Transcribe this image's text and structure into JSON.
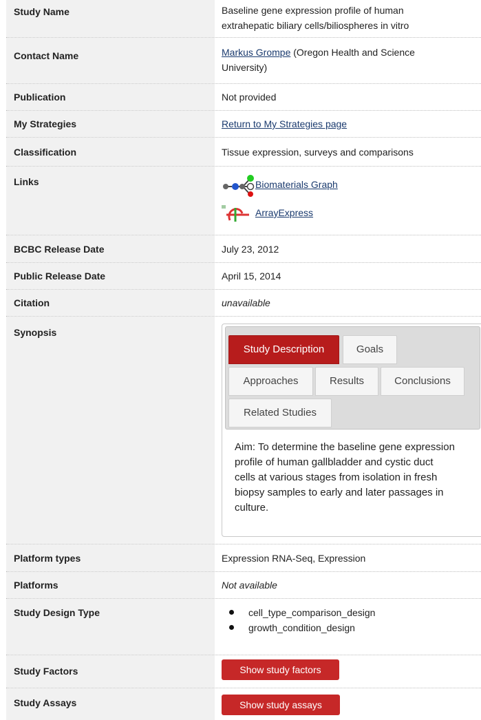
{
  "rows": {
    "study_name": {
      "label": "Study Name",
      "value": "Baseline gene expression profile of human extrahepatic biliary cells/biliospheres in vitro"
    },
    "contact_name": {
      "label": "Contact Name",
      "link": "Markus Grompe",
      "rest": " (Oregon Health and Science University)"
    },
    "publication": {
      "label": "Publication",
      "value": "Not provided"
    },
    "my_strategies": {
      "label": "My Strategies",
      "link": "Return to My Strategies page"
    },
    "classification": {
      "label": "Classification",
      "value": "Tissue expression, surveys and comparisons"
    },
    "links": {
      "label": "Links",
      "items": [
        {
          "icon": "biomaterials-graph-icon",
          "label": "Biomaterials Graph"
        },
        {
          "icon": "arrayexpress-icon",
          "label": "ArrayExpress"
        }
      ]
    },
    "bcbc_release": {
      "label": "BCBC Release Date",
      "value": "July 23, 2012"
    },
    "public_release": {
      "label": "Public Release Date",
      "value": "April 15, 2014"
    },
    "citation": {
      "label": "Citation",
      "value": "unavailable"
    },
    "synopsis": {
      "label": "Synopsis",
      "tabs": [
        "Study Description",
        "Goals",
        "Approaches",
        "Results",
        "Conclusions",
        "Related Studies"
      ],
      "active_tab": "Study Description",
      "text": "Aim: To determine the baseline gene expression profile of human gallbladder and cystic duct cells at various stages from isolation in fresh biopsy samples to early and later passages in culture."
    },
    "platform_types": {
      "label": "Platform types",
      "value": "Expression RNA-Seq, Expression"
    },
    "platforms": {
      "label": "Platforms",
      "value": "Not available"
    },
    "design_type": {
      "label": "Study Design Type",
      "items": [
        "cell_type_comparison_design",
        "growth_condition_design"
      ]
    },
    "factors": {
      "label": "Study Factors",
      "button": "Show study factors"
    },
    "assays": {
      "label": "Study Assays",
      "button": "Show study assays"
    }
  },
  "colors": {
    "accent": "#c62828",
    "label_bg": "#f1f1f1",
    "link": "#1a3a6e"
  }
}
